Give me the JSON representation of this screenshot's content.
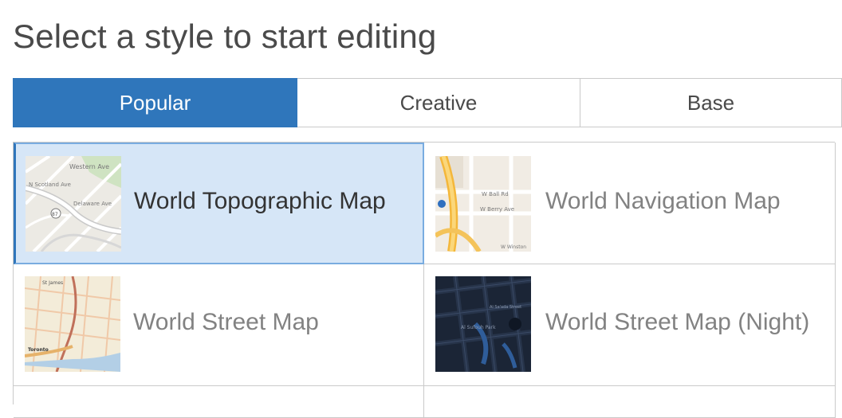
{
  "header": {
    "title": "Select a style to start editing"
  },
  "tabs": [
    {
      "label": "Popular",
      "active": true
    },
    {
      "label": "Creative",
      "active": false
    },
    {
      "label": "Base",
      "active": false
    }
  ],
  "styles": [
    {
      "name": "World Topographic Map",
      "selected": true,
      "thumbnail_icon": "topographic-map-thumbnail",
      "thumbnail_labels": [
        "Western Ave",
        "N Scotland Ave",
        "Delaware Ave",
        "87"
      ]
    },
    {
      "name": "World Navigation Map",
      "selected": false,
      "thumbnail_icon": "navigation-map-thumbnail",
      "thumbnail_labels": [
        "W Ball Rd",
        "W Berry Ave",
        "W Winston"
      ]
    },
    {
      "name": "World Street Map",
      "selected": false,
      "thumbnail_icon": "street-map-thumbnail",
      "thumbnail_labels": [
        "St James",
        "Toronto"
      ]
    },
    {
      "name": "World Street Map (Night)",
      "selected": false,
      "thumbnail_icon": "street-map-night-thumbnail",
      "thumbnail_labels": [
        "Al Sufouh Park",
        "Al Sa'ada Street"
      ]
    }
  ],
  "colors": {
    "accent": "#2f76bb",
    "selected_background": "#d6e6f7",
    "border": "#cacaca"
  }
}
